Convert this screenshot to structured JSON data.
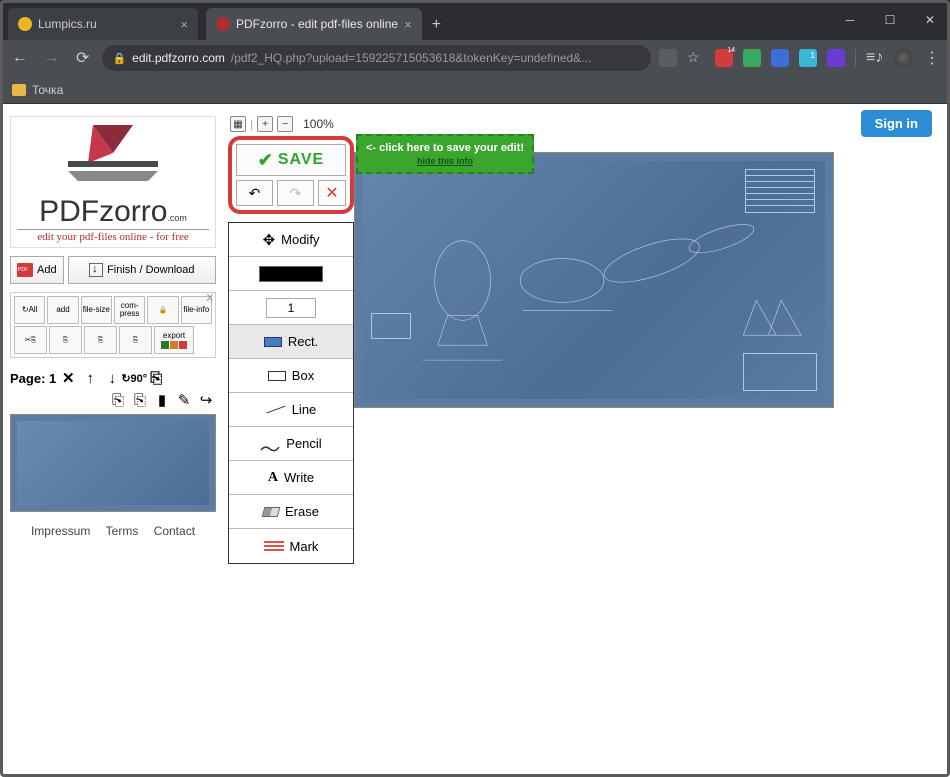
{
  "browser": {
    "tabs": [
      {
        "title": "Lumpics.ru",
        "favicon": "yellow"
      },
      {
        "title": "PDFzorro - edit pdf-files online",
        "favicon": "red",
        "active": true
      }
    ],
    "url_host": "edit.pdfzorro.com",
    "url_path": "/pdf2_HQ.php?upload=159225715053618&tokenKey=undefined&...",
    "bookmark": "Точка"
  },
  "header": {
    "sign_in": "Sign in"
  },
  "logo": {
    "brand": "PDFzorro",
    "com": ".com",
    "tagline": "edit your pdf-files online - for free"
  },
  "side_actions": {
    "add": "Add",
    "finish": "Finish / Download"
  },
  "toolgrid": {
    "row1": [
      "↻All",
      "add",
      "file-size",
      "com-press",
      "🔒",
      "file-info"
    ],
    "row2": [
      "✂⎘",
      "⎘",
      "⎘",
      "⎘",
      "export"
    ]
  },
  "page_ctrl": {
    "label": "Page: 1",
    "ops1": [
      "✕",
      "↑",
      "↓",
      "↻90°",
      "⎘"
    ],
    "ops2": [
      "⎘",
      "⎘",
      "▮",
      "✎",
      "↪"
    ]
  },
  "footer": {
    "impressum": "Impressum",
    "terms": "Terms",
    "contact": "Contact"
  },
  "zoom": {
    "level": "100%"
  },
  "save_panel": {
    "save": "SAVE",
    "hint": "<- click here to save your edit!",
    "hide": "hide this info"
  },
  "tools": {
    "modify": "Modify",
    "thickness": "1",
    "rect": "Rect.",
    "box": "Box",
    "line": "Line",
    "pencil": "Pencil",
    "write": "Write",
    "erase": "Erase",
    "mark": "Mark"
  }
}
